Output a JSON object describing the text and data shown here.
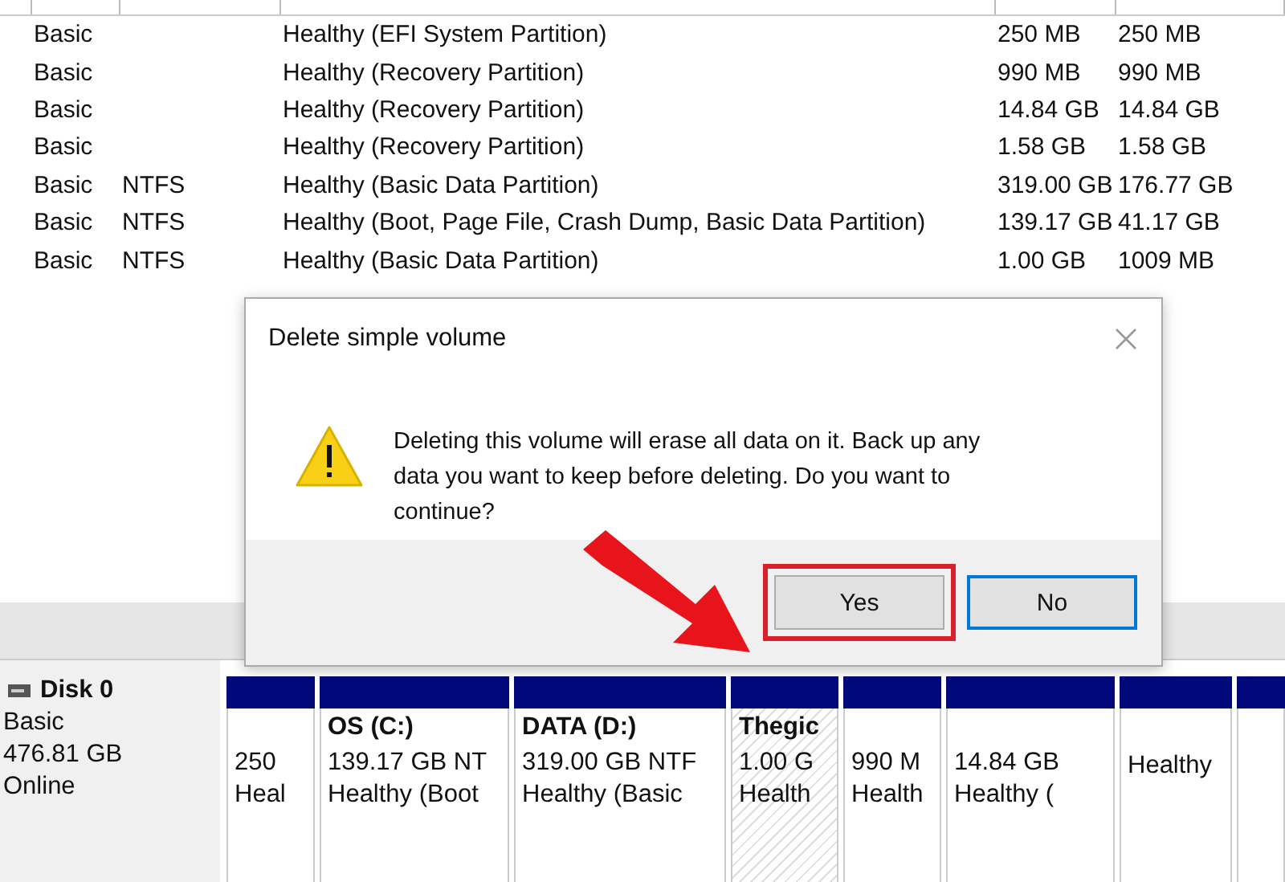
{
  "volume_table": {
    "rows": [
      {
        "type": "Basic",
        "file_system": "",
        "status": "Healthy (EFI System Partition)",
        "capacity": "250 MB",
        "free_space": "250 MB"
      },
      {
        "type": "Basic",
        "file_system": "",
        "status": "Healthy (Recovery Partition)",
        "capacity": "990 MB",
        "free_space": "990 MB"
      },
      {
        "type": "Basic",
        "file_system": "",
        "status": "Healthy (Recovery Partition)",
        "capacity": "14.84 GB",
        "free_space": "14.84 GB"
      },
      {
        "type": "Basic",
        "file_system": "",
        "status": "Healthy (Recovery Partition)",
        "capacity": "1.58 GB",
        "free_space": "1.58 GB"
      },
      {
        "type": "Basic",
        "file_system": "NTFS",
        "status": "Healthy (Basic Data Partition)",
        "capacity": "319.00 GB",
        "free_space": "176.77 GB"
      },
      {
        "type": "Basic",
        "file_system": "NTFS",
        "status": "Healthy (Boot, Page File, Crash Dump, Basic Data Partition)",
        "capacity": "139.17 GB",
        "free_space": "41.17 GB"
      },
      {
        "type": "Basic",
        "file_system": "NTFS",
        "status": "Healthy (Basic Data Partition)",
        "capacity": "1.00 GB",
        "free_space": "1009 MB"
      }
    ]
  },
  "dialog": {
    "title": "Delete simple volume",
    "message": "Deleting this volume will erase all data on it. Back up any data you want to keep before deleting. Do you want to continue?",
    "buttons": [
      {
        "label": "Yes",
        "highlighted": true
      },
      {
        "label": "No",
        "highlighted": false
      }
    ]
  },
  "disk": {
    "name": "Disk 0",
    "type": "Basic",
    "size": "476.81 GB",
    "status": "Online",
    "partitions": [
      {
        "size": "250",
        "status": "Heal",
        "selected": false
      },
      {
        "name": "OS  (C:)",
        "size": "139.17 GB NT",
        "status": "Healthy (Boot",
        "selected": false
      },
      {
        "name": "DATA  (D:)",
        "size": "319.00 GB NTF",
        "status": "Healthy (Basic",
        "selected": false
      },
      {
        "name": "Thegic",
        "size": "1.00 G",
        "status": "Health",
        "selected": true
      },
      {
        "size": "990 M",
        "status": "Health",
        "selected": false
      },
      {
        "size": "14.84 GB",
        "status": "Healthy (",
        "selected": false
      },
      {
        "status": "Healthy",
        "selected": false
      },
      {
        "selected": false
      }
    ]
  }
}
